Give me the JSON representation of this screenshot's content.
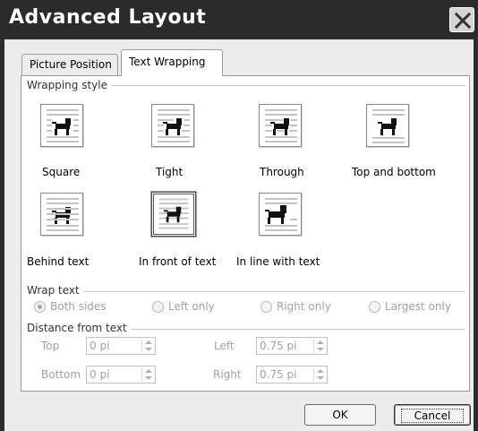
{
  "window": {
    "title": "Advanced Layout"
  },
  "tabs": [
    {
      "label": "Picture Position",
      "active": false
    },
    {
      "label": "Text Wrapping",
      "active": true
    }
  ],
  "wrapping_style": {
    "heading": "Wrapping style",
    "options": [
      {
        "label": "Square",
        "icon": "wrap-square-icon"
      },
      {
        "label": "Tight",
        "icon": "wrap-tight-icon"
      },
      {
        "label": "Through",
        "icon": "wrap-through-icon"
      },
      {
        "label": "Top and bottom",
        "icon": "wrap-top-bottom-icon"
      },
      {
        "label": "Behind text",
        "icon": "wrap-behind-text-icon"
      },
      {
        "label": "In front of text",
        "icon": "wrap-in-front-icon",
        "selected": true
      },
      {
        "label": "In line with text",
        "icon": "wrap-inline-icon"
      }
    ]
  },
  "wrap_text": {
    "heading": "Wrap text",
    "options": [
      {
        "label": "Both sides",
        "checked": true,
        "enabled": false
      },
      {
        "label": "Left only",
        "checked": false,
        "enabled": false
      },
      {
        "label": "Right only",
        "checked": false,
        "enabled": false
      },
      {
        "label": "Largest only",
        "checked": false,
        "enabled": false
      }
    ]
  },
  "distance": {
    "heading": "Distance from text",
    "top": {
      "label": "Top",
      "value": "0 pi"
    },
    "bottom": {
      "label": "Bottom",
      "value": "0 pi"
    },
    "left": {
      "label": "Left",
      "value": "0.75 pi"
    },
    "right": {
      "label": "Right",
      "value": "0.75 pi"
    }
  },
  "buttons": {
    "ok": "OK",
    "cancel": "Cancel"
  },
  "colors": {
    "titlebar": "#2b2b2b",
    "dialog": "#ececec",
    "disabled_text": "#a0a0a0"
  }
}
